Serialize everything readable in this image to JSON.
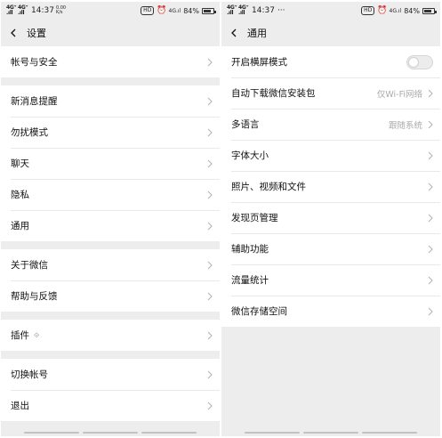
{
  "status_bar": {
    "signal1": "4G⁺\n.ıll",
    "signal2": "4G⁺\n.ıll",
    "time": "14:37",
    "net_speed": "0.00\nK/s",
    "hd_badge": "HD",
    "signal_4g": "4G.ıl",
    "battery_pct": "84%",
    "battery_level": 0.84,
    "more_dots": "···"
  },
  "left_screen": {
    "title": "设置",
    "groups": [
      [
        {
          "label": "帐号与安全"
        }
      ],
      [
        {
          "label": "新消息提醒"
        },
        {
          "label": "勿扰模式"
        },
        {
          "label": "聊天"
        },
        {
          "label": "隐私"
        },
        {
          "label": "通用"
        }
      ],
      [
        {
          "label": "关于微信"
        },
        {
          "label": "帮助与反馈"
        }
      ],
      [
        {
          "label": "插件",
          "icon": "puzzle-icon"
        }
      ],
      [
        {
          "label": "切换帐号"
        },
        {
          "label": "退出"
        }
      ]
    ]
  },
  "right_screen": {
    "title": "通用",
    "items": [
      {
        "label": "开启横屏模式",
        "toggle": true,
        "toggle_on": false
      },
      {
        "label": "自动下载微信安装包",
        "value": "仅Wi-Fi网络"
      },
      {
        "label": "多语言",
        "value": "跟随系统"
      },
      {
        "label": "字体大小"
      },
      {
        "label": "照片、视频和文件"
      },
      {
        "label": "发现页管理"
      },
      {
        "label": "辅助功能"
      },
      {
        "label": "流量统计"
      },
      {
        "label": "微信存储空间"
      }
    ]
  },
  "colors": {
    "background": "#ededed",
    "card": "#ffffff",
    "secondary_text": "#aaaaaa",
    "chevron": "#b5b5b5"
  }
}
